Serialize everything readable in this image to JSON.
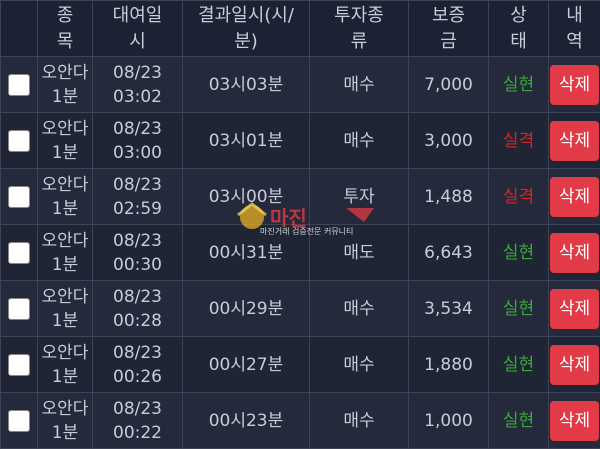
{
  "headers": {
    "item": "종\n목",
    "rent_time": "대여일\n시",
    "result_time": "결과일시(시/\n분)",
    "type": "투자종\n류",
    "deposit": "보증\n금",
    "status": "상\n태",
    "detail": "내\n역"
  },
  "rows": [
    {
      "item": "오안다\n1분",
      "date": "08/23\n03:02",
      "result": "03시03분",
      "type": "매수",
      "deposit": "7,000",
      "status": "실현",
      "status_kind": "win",
      "action": "삭제"
    },
    {
      "item": "오안다\n1분",
      "date": "08/23\n03:00",
      "result": "03시01분",
      "type": "매수",
      "deposit": "3,000",
      "status": "실격",
      "status_kind": "lose",
      "action": "삭제"
    },
    {
      "item": "오안다\n1분",
      "date": "08/23\n02:59",
      "result": "03시00분",
      "type": "투자",
      "deposit": "1,488",
      "status": "실격",
      "status_kind": "lose",
      "action": "삭제"
    },
    {
      "item": "오안다\n1분",
      "date": "08/23\n00:30",
      "result": "00시31분",
      "type": "매도",
      "deposit": "6,643",
      "status": "실현",
      "status_kind": "win",
      "action": "삭제"
    },
    {
      "item": "오안다\n1분",
      "date": "08/23\n00:28",
      "result": "00시29분",
      "type": "매수",
      "deposit": "3,534",
      "status": "실현",
      "status_kind": "win",
      "action": "삭제"
    },
    {
      "item": "오안다\n1분",
      "date": "08/23\n00:26",
      "result": "00시27분",
      "type": "매수",
      "deposit": "1,880",
      "status": "실현",
      "status_kind": "win",
      "action": "삭제"
    },
    {
      "item": "오안다\n1분",
      "date": "08/23\n00:22",
      "result": "00시23분",
      "type": "매수",
      "deposit": "1,000",
      "status": "실현",
      "status_kind": "win",
      "action": "삭제"
    }
  ],
  "watermark": {
    "title": "마진",
    "sub": "마진거래 검증전문 커뮤니티"
  },
  "colors": {
    "win": "#3ea63e",
    "lose": "#cc2a2a",
    "delete_button": "#e23a47"
  }
}
